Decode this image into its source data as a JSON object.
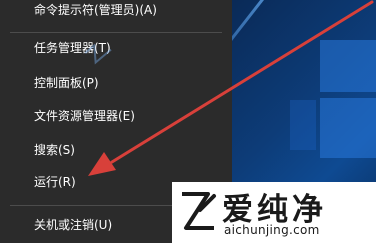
{
  "menu": {
    "items": [
      {
        "label": "命令提示符(管理员)(A)"
      },
      {
        "label": "任务管理器(T)"
      },
      {
        "label": "控制面板(P)"
      },
      {
        "label": "文件资源管理器(E)"
      },
      {
        "label": "搜索(S)"
      },
      {
        "label": "运行(R)"
      },
      {
        "label": "关机或注销(U)"
      }
    ]
  },
  "annotation": {
    "arrow_color": "#d8403a"
  },
  "watermark": {
    "logo_text": "爱纯净",
    "url": "aichunjing.com"
  }
}
